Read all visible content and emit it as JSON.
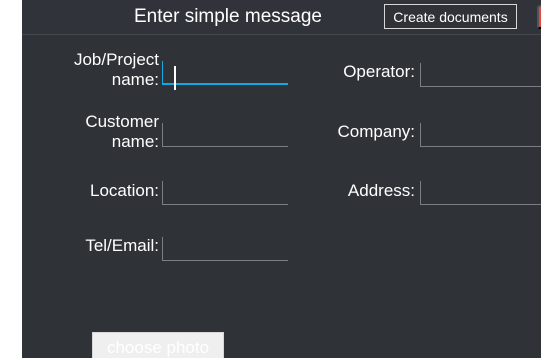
{
  "dialog": {
    "title": "Enter simple message",
    "create_documents_label": "Create documents",
    "close_icon": "close-icon",
    "close_symbol": "×"
  },
  "form": {
    "fields": [
      {
        "label": "Job/Project\nname:",
        "value": "",
        "active": true
      },
      {
        "label": "Operator:",
        "value": ""
      },
      {
        "label": "Customer\nname:",
        "value": ""
      },
      {
        "label": "Company:",
        "value": ""
      },
      {
        "label": "Location:",
        "value": ""
      },
      {
        "label": "Address:",
        "value": ""
      },
      {
        "label": "Tel/Email:",
        "value": ""
      }
    ]
  },
  "actions": {
    "choose_photo_label": "choose photo"
  },
  "colors": {
    "panel_background": "#2f3237",
    "text": "#ffffff",
    "active_field_accent": "#11a9df",
    "close_button": "#e4473f",
    "field_border": "#7b7f85"
  }
}
